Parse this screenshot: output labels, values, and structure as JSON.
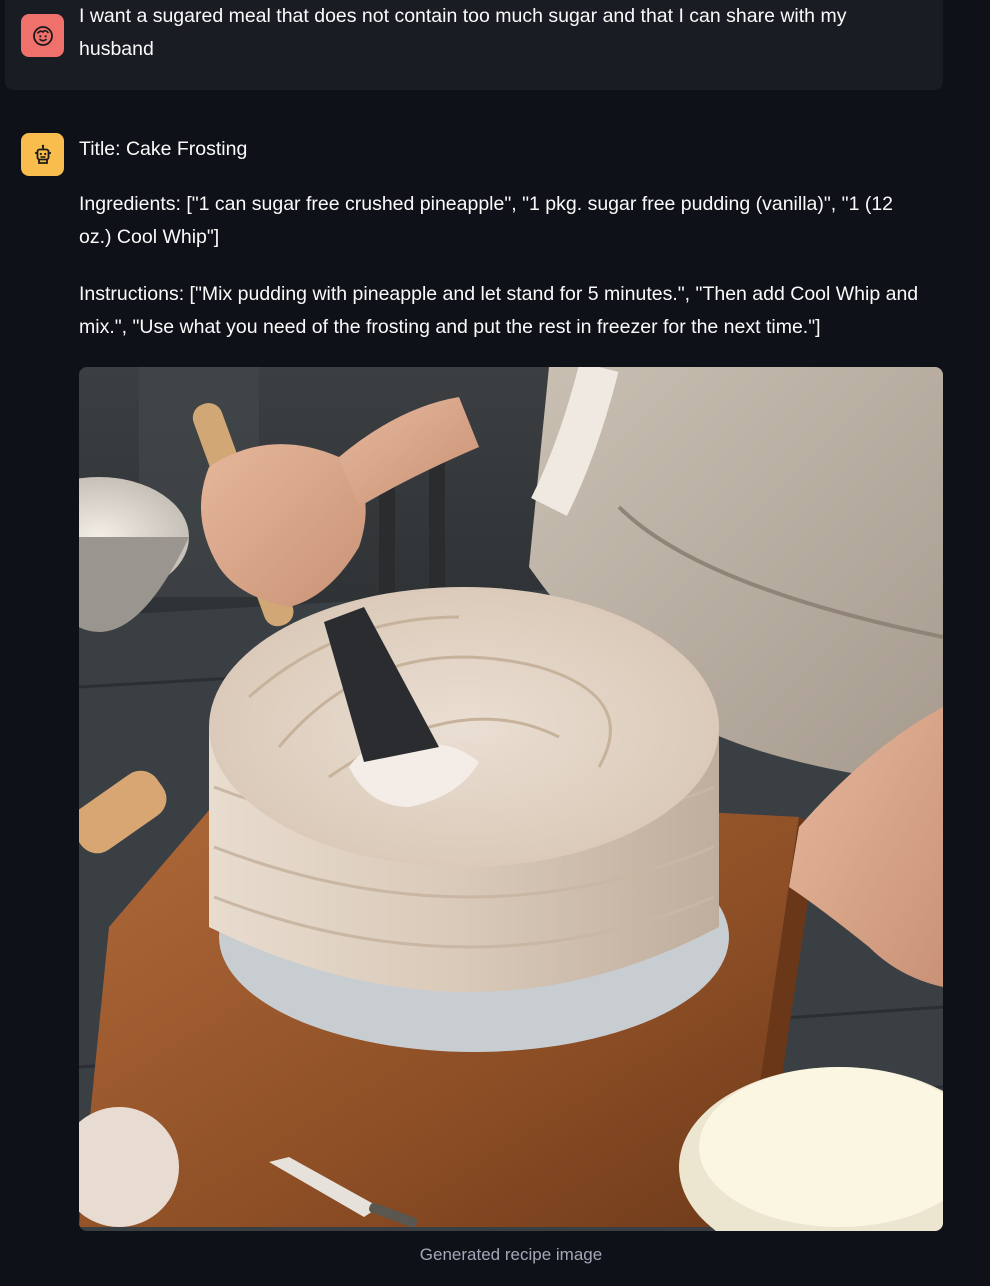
{
  "user_message": {
    "avatar_icon": "smiley-face-icon",
    "avatar_color": "#f0716b",
    "text": "I want a sugared meal that does not contain too much sugar and that I can share with my husband"
  },
  "assistant_message": {
    "avatar_icon": "robot-face-icon",
    "avatar_color": "#f8bd4d",
    "title": "Title: Cake Frosting",
    "ingredients": "Ingredients: [\"1 can sugar free crushed pineapple\", \"1 pkg. sugar free pudding (vanilla)\", \"1 (12 oz.) Cool Whip\"]",
    "instructions": "Instructions: [\"Mix pudding with pineapple and let stand for 5 minutes.\", \"Then add Cool Whip and mix.\", \"Use what you need of the frosting and put the rest in freezer for the next time.\"]",
    "image_caption": "Generated recipe image"
  },
  "theme": {
    "background": "#0e1117",
    "user_bubble": "#1a1c24",
    "text": "#fafafa",
    "caption": "#a3a8b8"
  }
}
